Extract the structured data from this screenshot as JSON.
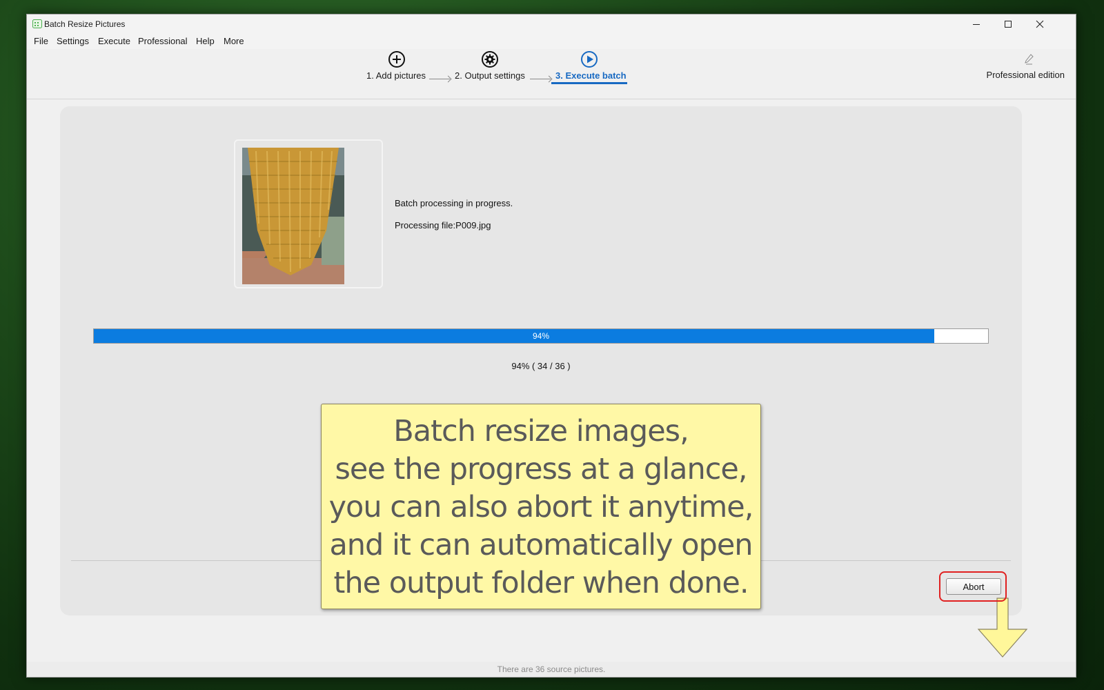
{
  "window": {
    "title": "Batch Resize Pictures",
    "app_icon": "calendar-grid-icon"
  },
  "window_controls": {
    "minimize_icon": "minimize-icon",
    "maximize_icon": "maximize-icon",
    "close_icon": "close-icon"
  },
  "menu": {
    "items": [
      "File",
      "Settings",
      "Execute",
      "Professional",
      "Help",
      "More"
    ]
  },
  "steps": [
    {
      "label": "1. Add pictures",
      "icon": "plus-circle-icon",
      "active": false
    },
    {
      "label": "2. Output settings",
      "icon": "gear-icon",
      "active": false
    },
    {
      "label": "3. Execute batch",
      "icon": "play-circle-icon",
      "active": true
    }
  ],
  "edition": {
    "label": "Professional edition",
    "icon": "pen-icon"
  },
  "status": {
    "line1": "Batch processing in progress.",
    "line2": "Processing file:P009.jpg",
    "thumbnail": "corn-photo-thumbnail"
  },
  "progress": {
    "percent": 94,
    "bar_text": "94%",
    "summary": "94% ( 34 / 36 )"
  },
  "abort": {
    "label": "Abort"
  },
  "callout": {
    "lines": [
      "Batch resize images,",
      "see the progress at a glance,",
      "you can also abort it anytime,",
      "and it can automatically open",
      "the output folder when done."
    ]
  },
  "statusbar": {
    "text": "There are 36 source pictures."
  },
  "colors": {
    "accent": "#1769c2",
    "progress_fill": "#0b7ce0",
    "callout_bg": "#fff8a6",
    "highlight": "#e02020"
  }
}
